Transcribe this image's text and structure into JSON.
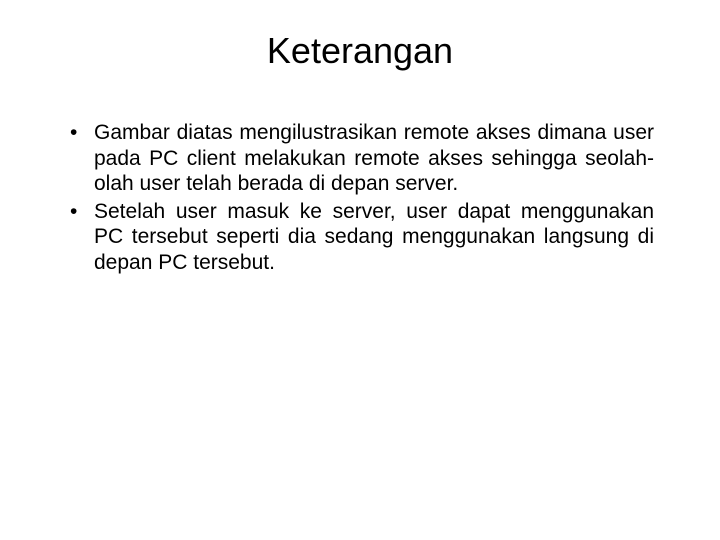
{
  "title": "Keterangan",
  "bullets": [
    "Gambar diatas mengilustrasikan remote akses dimana user pada PC client melakukan remote akses sehingga seolah-olah user telah berada di depan server.",
    "Setelah user masuk ke server, user dapat menggunakan PC tersebut seperti dia sedang menggunakan langsung di depan PC tersebut."
  ]
}
